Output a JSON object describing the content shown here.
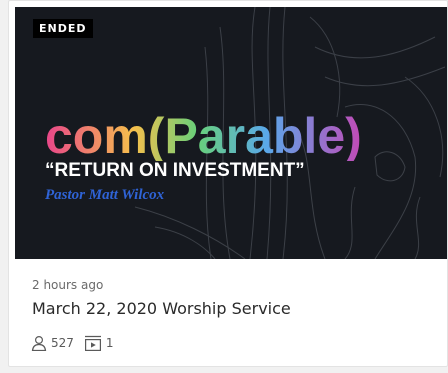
{
  "card": {
    "status_badge": "ENDED",
    "thumbnail": {
      "headline": "com(Parable)",
      "subtitle": "“RETURN ON INVESTMENT”",
      "speaker": "Pastor Matt Wilcox"
    },
    "time_ago": "2 hours ago",
    "title": "March 22, 2020 Worship Service",
    "stats": {
      "viewers_icon": "person-icon",
      "viewers": "527",
      "media_icon": "video-playlist-icon",
      "media_count": "1"
    }
  },
  "colors": {
    "badge_bg": "#000000",
    "thumbnail_bg": "#16191f",
    "speaker_text": "#2f63d6",
    "title_text": "#2a2a2a",
    "meta_text": "#6a6a6a"
  }
}
